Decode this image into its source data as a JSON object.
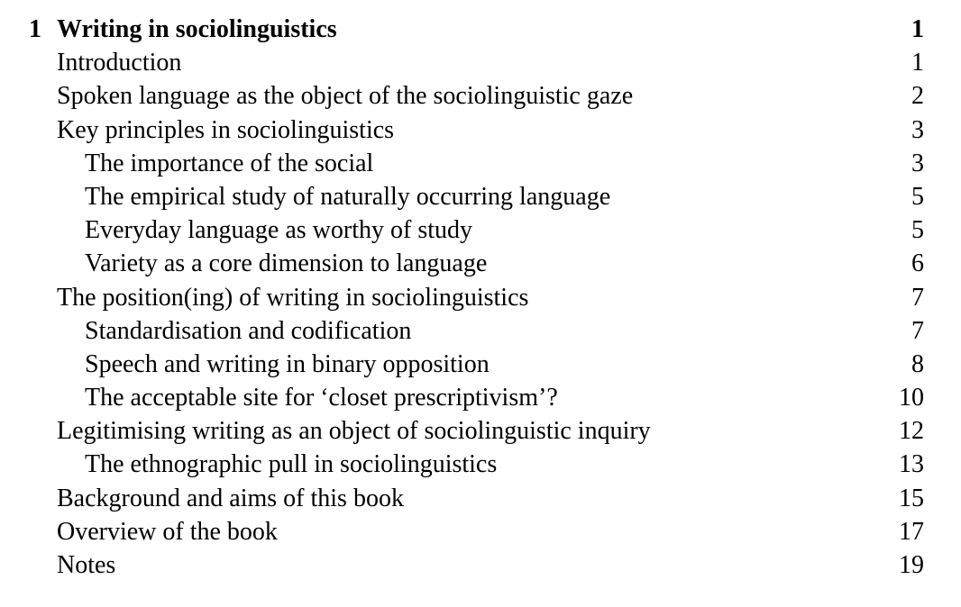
{
  "chapter": {
    "number": "1",
    "title": "Writing in sociolinguistics",
    "page": "1"
  },
  "entries": [
    {
      "title": "Introduction",
      "page": "1"
    },
    {
      "title": "Spoken language as the object of the sociolinguistic gaze",
      "page": "2"
    },
    {
      "title": "Key principles in sociolinguistics",
      "page": "3"
    },
    {
      "title": "The importance of the social",
      "page": "3"
    },
    {
      "title": "The empirical study of naturally occurring language",
      "page": "5"
    },
    {
      "title": "Everyday language as worthy of study",
      "page": "5"
    },
    {
      "title": "Variety as a core dimension to language",
      "page": "6"
    },
    {
      "title": "The position(ing) of writing in sociolinguistics",
      "page": "7"
    },
    {
      "title": "Standardisation and codification",
      "page": "7"
    },
    {
      "title": "Speech and writing in binary opposition",
      "page": "8"
    },
    {
      "title": "The acceptable site for ‘closet prescriptivism’?",
      "page": "10"
    },
    {
      "title": "Legitimising writing as an object of sociolinguistic inquiry",
      "page": "12"
    },
    {
      "title": "The ethnographic pull in sociolinguistics",
      "page": "13"
    },
    {
      "title": "Background and aims of this book",
      "page": "15"
    },
    {
      "title": "Overview of the book",
      "page": "17"
    },
    {
      "title": "Notes",
      "page": "19"
    }
  ]
}
